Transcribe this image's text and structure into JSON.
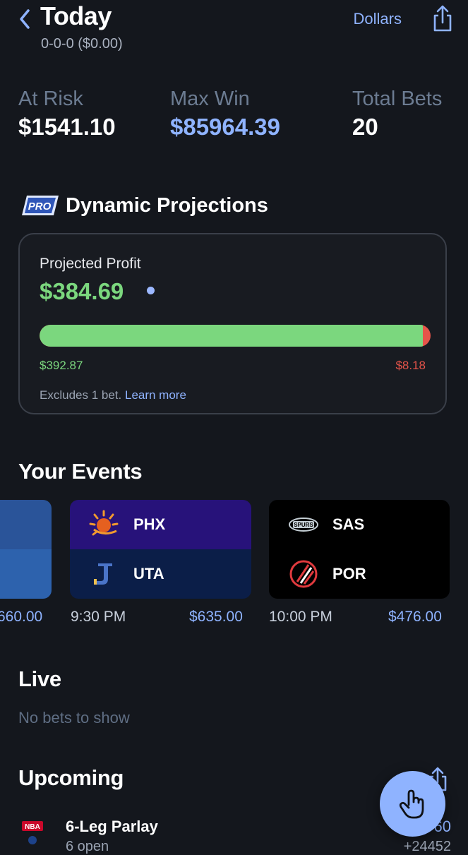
{
  "header": {
    "title": "Today",
    "record": "0-0-0 ($0.00)",
    "currency_toggle": "Dollars"
  },
  "stats": [
    {
      "label": "At Risk",
      "value": "$1541.10",
      "color": "#ffffff"
    },
    {
      "label": "Max Win",
      "value": "$85964.39",
      "color": "#8fb3ff"
    },
    {
      "label": "Total Bets",
      "value": "20",
      "color": "#ffffff"
    }
  ],
  "projections": {
    "badge": "PRO",
    "title": "Dynamic Projections",
    "label": "Projected Profit",
    "value": "$384.69",
    "win_amount": "$392.87",
    "loss_amount": "$8.18",
    "win_fraction": 0.98,
    "excludes_text": "Excludes 1 bet.",
    "learn_more": "Learn more"
  },
  "events": {
    "title": "Your Events",
    "items": [
      {
        "away": "",
        "home": "",
        "time": "",
        "amount": "660.00",
        "colors": [
          "#2a5499",
          "#2d62ad"
        ]
      },
      {
        "away": "PHX",
        "home": "UTA",
        "time": "9:30 PM",
        "amount": "$635.00",
        "colors": [
          "#27127a",
          "#0b1e48"
        ]
      },
      {
        "away": "SAS",
        "home": "POR",
        "time": "10:00 PM",
        "amount": "$476.00",
        "colors": [
          "#000000",
          "#000000"
        ]
      }
    ]
  },
  "live": {
    "title": "Live",
    "empty": "No bets to show"
  },
  "upcoming": {
    "title": "Upcoming",
    "bets": [
      {
        "league": "NBA",
        "title": "6-Leg Parlay",
        "subtitle": "6 open",
        "amount": "60",
        "odds": "+24452"
      }
    ]
  },
  "icons": {
    "back": "chevron-left-icon",
    "share": "share-icon",
    "fab": "hand-pointer-icon"
  },
  "colors": {
    "background": "#14171d",
    "accent": "#8fb3ff",
    "positive": "#7bd77e",
    "negative": "#e6544a",
    "muted": "#6c7c92"
  }
}
